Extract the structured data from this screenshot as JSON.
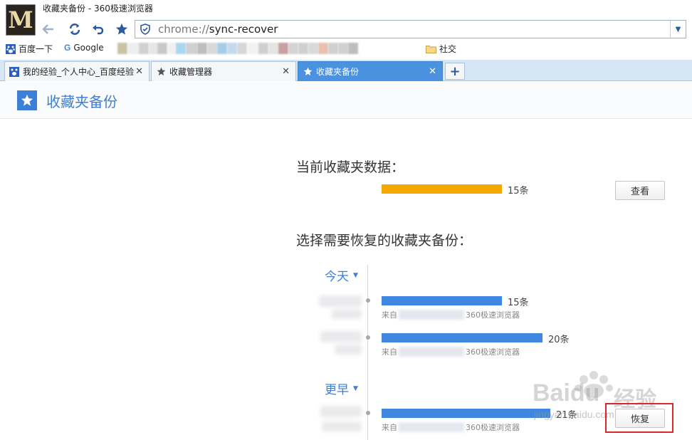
{
  "window": {
    "title": "收藏夹备份 - 360极速浏览器"
  },
  "address_bar": {
    "scheme": "chrome://",
    "path": "sync-recover"
  },
  "bookmarks_bar": {
    "items": [
      {
        "label": "百度一下",
        "icon": "paw-icon"
      },
      {
        "label": "Google",
        "icon": "google-icon"
      }
    ],
    "folder": {
      "label": "社交",
      "icon": "folder-icon"
    }
  },
  "tabs": [
    {
      "label": "我的经验_个人中心_百度经验",
      "icon": "paw-icon",
      "active": false
    },
    {
      "label": "收藏管理器",
      "icon": "star-icon",
      "active": false
    },
    {
      "label": "收藏夹备份",
      "icon": "star-icon",
      "active": true
    }
  ],
  "page": {
    "title": "收藏夹备份",
    "current": {
      "heading": "当前收藏夹数据：",
      "count_label": "15条",
      "count": 15,
      "view_button": "查看"
    },
    "backups": {
      "heading": "选择需要恢复的收藏夹备份：",
      "groups": [
        {
          "label": "今天",
          "entries": [
            {
              "count_label": "15条",
              "count": 15,
              "source_prefix": "来自",
              "source_suffix": "360极速浏览器"
            },
            {
              "count_label": "20条",
              "count": 20,
              "source_prefix": "来自",
              "source_suffix": "360极速浏览器"
            }
          ]
        },
        {
          "label": "更早",
          "entries": [
            {
              "count_label": "21条",
              "count": 21,
              "source_prefix": "来自",
              "source_suffix": "360极速浏览器",
              "restore_button": "恢复"
            }
          ]
        }
      ]
    }
  },
  "watermark": {
    "brand": "Baidu",
    "cn": "经验",
    "url": "jingyan.baidu.com"
  },
  "colors": {
    "accent": "#3d7fd6",
    "orange_bar": "#f7a800",
    "blue_bar": "#3f86e0",
    "highlight": "#d62a2a"
  }
}
